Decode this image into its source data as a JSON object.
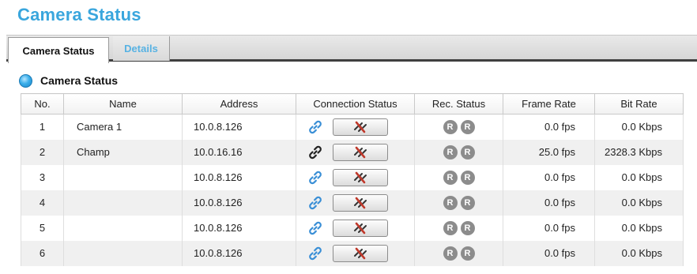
{
  "page": {
    "title": "Camera Status"
  },
  "tabs": [
    {
      "label": "Camera Status",
      "active": true
    },
    {
      "label": "Details",
      "active": false
    }
  ],
  "section": {
    "title": "Camera Status"
  },
  "colors": {
    "accent": "#3aa6dd",
    "link_blue": "#3a8fd6",
    "link_dark": "#222222",
    "badge": "#8c8c8c",
    "disconnect_red": "#c0392b"
  },
  "table": {
    "headers": [
      "No.",
      "Name",
      "Address",
      "Connection Status",
      "Rec. Status",
      "Frame Rate",
      "Bit Rate"
    ],
    "rows": [
      {
        "no": "1",
        "name": "Camera 1",
        "address": "10.0.8.126",
        "link_icon": "link-icon-blue",
        "rec": [
          "R",
          "R"
        ],
        "frame_rate": "0.0 fps",
        "bit_rate": "0.0 Kbps"
      },
      {
        "no": "2",
        "name": "Champ",
        "address": "10.0.16.16",
        "link_icon": "link-icon-dark",
        "rec": [
          "R",
          "R"
        ],
        "frame_rate": "25.0 fps",
        "bit_rate": "2328.3 Kbps"
      },
      {
        "no": "3",
        "name": "",
        "address": "10.0.8.126",
        "link_icon": "link-icon-blue",
        "rec": [
          "R",
          "R"
        ],
        "frame_rate": "0.0 fps",
        "bit_rate": "0.0 Kbps"
      },
      {
        "no": "4",
        "name": "",
        "address": "10.0.8.126",
        "link_icon": "link-icon-blue",
        "rec": [
          "R",
          "R"
        ],
        "frame_rate": "0.0 fps",
        "bit_rate": "0.0 Kbps"
      },
      {
        "no": "5",
        "name": "",
        "address": "10.0.8.126",
        "link_icon": "link-icon-blue",
        "rec": [
          "R",
          "R"
        ],
        "frame_rate": "0.0 fps",
        "bit_rate": "0.0 Kbps"
      },
      {
        "no": "6",
        "name": "",
        "address": "10.0.8.126",
        "link_icon": "link-icon-blue",
        "rec": [
          "R",
          "R"
        ],
        "frame_rate": "0.0 fps",
        "bit_rate": "0.0 Kbps"
      }
    ]
  }
}
